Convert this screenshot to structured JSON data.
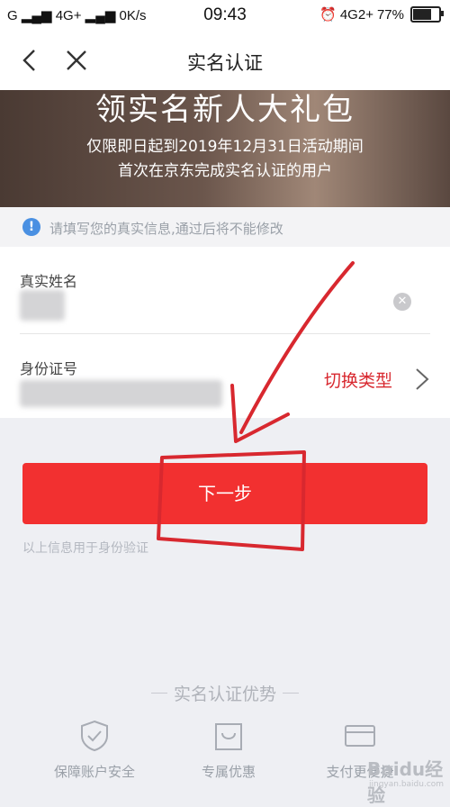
{
  "status_bar": {
    "carrier": "G",
    "network": "4G+",
    "speed": "0K/s",
    "time": "09:43",
    "network_right": "4G2+",
    "battery": "77%",
    "battery_level": 0.77
  },
  "nav": {
    "title": "实名认证"
  },
  "banner": {
    "title": "领实名新人大礼包",
    "line1": "仅限即日起到2019年12月31日活动期间",
    "line2": "首次在京东完成实名认证的用户"
  },
  "notice": {
    "text": "请填写您的真实信息,通过后将不能修改"
  },
  "form": {
    "name_label": "真实姓名",
    "id_label": "身份证号",
    "switch_type": "切换类型"
  },
  "next_button": {
    "label": "下一步"
  },
  "next_hint": "以上信息用于身份验证",
  "advantages": {
    "title": "实名认证优势",
    "items": [
      {
        "label": "保障账户安全",
        "icon": "shield-icon"
      },
      {
        "label": "专属优惠",
        "icon": "shopping-bag-icon"
      },
      {
        "label": "支付更便捷",
        "icon": "card-icon"
      }
    ]
  },
  "colors": {
    "primary_red": "#f23030",
    "annotation_red": "#d8282f",
    "info_blue": "#4a90e2"
  },
  "watermark": {
    "text": "Baidu经验",
    "sub": "jingyan.baidu.com"
  }
}
